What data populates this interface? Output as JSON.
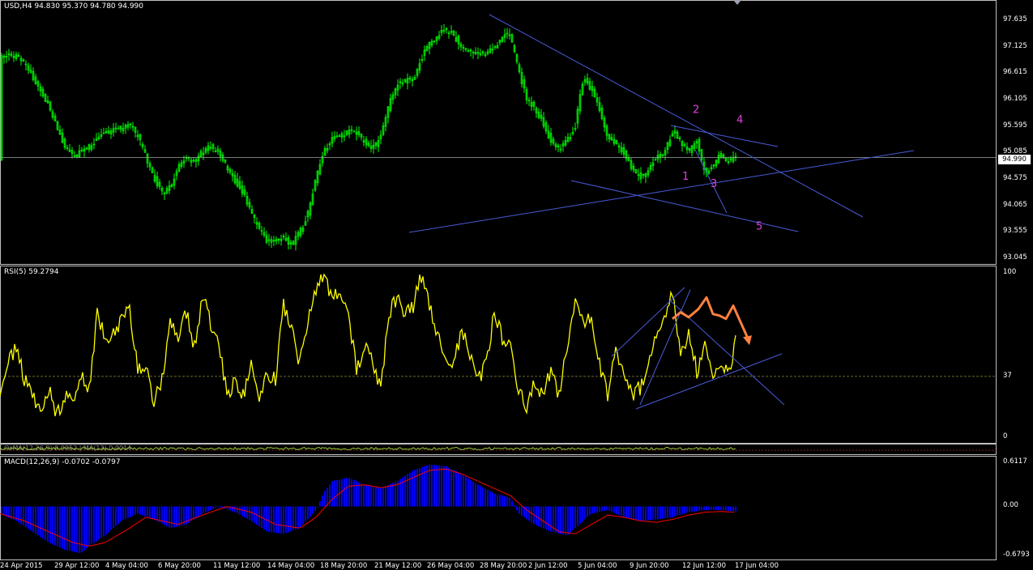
{
  "chart_data": [
    {
      "type": "candlestick",
      "title": "USD,H4  94.830 95.370 94.780 94.990",
      "ylim": [
        93.0,
        97.9
      ],
      "y_ticks": [
        "97.635",
        "97.125",
        "96.615",
        "96.105",
        "95.595",
        "95.085",
        "94.575",
        "94.065",
        "93.555",
        "93.045"
      ],
      "current_price": "94.990",
      "price_path": [
        [
          0,
          96.95
        ],
        [
          10,
          96.95
        ],
        [
          20,
          96.95
        ],
        [
          30,
          96.8
        ],
        [
          40,
          96.55
        ],
        [
          50,
          96.3
        ],
        [
          60,
          96.0
        ],
        [
          70,
          95.6
        ],
        [
          80,
          95.2
        ],
        [
          90,
          95.0
        ],
        [
          100,
          95.1
        ],
        [
          110,
          95.2
        ],
        [
          120,
          95.35
        ],
        [
          130,
          95.45
        ],
        [
          140,
          95.5
        ],
        [
          150,
          95.55
        ],
        [
          160,
          95.65
        ],
        [
          170,
          95.4
        ],
        [
          180,
          95.0
        ],
        [
          190,
          94.6
        ],
        [
          200,
          94.3
        ],
        [
          210,
          94.4
        ],
        [
          220,
          94.8
        ],
        [
          230,
          95.0
        ],
        [
          240,
          94.9
        ],
        [
          250,
          95.1
        ],
        [
          260,
          95.2
        ],
        [
          270,
          95.1
        ],
        [
          280,
          94.8
        ],
        [
          290,
          94.55
        ],
        [
          300,
          94.3
        ],
        [
          310,
          93.9
        ],
        [
          320,
          93.6
        ],
        [
          330,
          93.35
        ],
        [
          340,
          93.4
        ],
        [
          350,
          93.45
        ],
        [
          360,
          93.3
        ],
        [
          370,
          93.55
        ],
        [
          380,
          93.9
        ],
        [
          390,
          94.6
        ],
        [
          400,
          95.1
        ],
        [
          410,
          95.35
        ],
        [
          420,
          95.4
        ],
        [
          430,
          95.5
        ],
        [
          440,
          95.45
        ],
        [
          450,
          95.3
        ],
        [
          460,
          95.15
        ],
        [
          470,
          95.4
        ],
        [
          480,
          96.0
        ],
        [
          490,
          96.4
        ],
        [
          500,
          96.45
        ],
        [
          510,
          96.5
        ],
        [
          520,
          96.9
        ],
        [
          530,
          97.2
        ],
        [
          540,
          97.35
        ],
        [
          550,
          97.45
        ],
        [
          560,
          97.35
        ],
        [
          570,
          97.1
        ],
        [
          580,
          97.05
        ],
        [
          590,
          96.95
        ],
        [
          600,
          97.0
        ],
        [
          610,
          97.1
        ],
        [
          620,
          97.35
        ],
        [
          630,
          97.3
        ],
        [
          640,
          96.7
        ],
        [
          650,
          96.1
        ],
        [
          660,
          95.95
        ],
        [
          670,
          95.65
        ],
        [
          680,
          95.3
        ],
        [
          690,
          95.15
        ],
        [
          700,
          95.3
        ],
        [
          710,
          95.6
        ],
        [
          720,
          96.55
        ],
        [
          730,
          96.3
        ],
        [
          740,
          95.9
        ],
        [
          750,
          95.4
        ],
        [
          760,
          95.25
        ],
        [
          770,
          95.1
        ],
        [
          780,
          94.8
        ],
        [
          790,
          94.6
        ],
        [
          800,
          94.75
        ],
        [
          810,
          95.0
        ],
        [
          820,
          95.1
        ],
        [
          830,
          95.5
        ],
        [
          840,
          95.3
        ],
        [
          850,
          95.1
        ],
        [
          860,
          95.35
        ],
        [
          870,
          94.7
        ],
        [
          880,
          94.85
        ],
        [
          890,
          95.05
        ],
        [
          900,
          94.9
        ],
        [
          908,
          94.99
        ]
      ],
      "annotations": [
        {
          "text": "1",
          "x": 842,
          "y": 94.56
        },
        {
          "text": "2",
          "x": 855,
          "y": 95.85
        },
        {
          "text": "3",
          "x": 877,
          "y": 94.42
        },
        {
          "text": "4",
          "x": 909,
          "y": 95.65
        },
        {
          "text": "5",
          "x": 933,
          "y": 93.6
        }
      ]
    },
    {
      "type": "line",
      "title": "RSI(5) 59.2794",
      "ylim": [
        0,
        100
      ],
      "y_ticks": [
        "100",
        "37",
        "0"
      ],
      "level": 37,
      "series_path": [
        [
          0,
          30
        ],
        [
          10,
          45
        ],
        [
          20,
          55
        ],
        [
          30,
          35
        ],
        [
          40,
          25
        ],
        [
          50,
          17
        ],
        [
          60,
          30
        ],
        [
          70,
          12
        ],
        [
          80,
          25
        ],
        [
          90,
          20
        ],
        [
          100,
          40
        ],
        [
          110,
          30
        ],
        [
          120,
          75
        ],
        [
          130,
          60
        ],
        [
          140,
          65
        ],
        [
          150,
          70
        ],
        [
          160,
          80
        ],
        [
          170,
          40
        ],
        [
          180,
          45
        ],
        [
          190,
          20
        ],
        [
          200,
          35
        ],
        [
          210,
          70
        ],
        [
          220,
          60
        ],
        [
          230,
          75
        ],
        [
          240,
          55
        ],
        [
          250,
          85
        ],
        [
          260,
          70
        ],
        [
          270,
          60
        ],
        [
          280,
          25
        ],
        [
          290,
          35
        ],
        [
          300,
          25
        ],
        [
          310,
          45
        ],
        [
          320,
          20
        ],
        [
          330,
          40
        ],
        [
          340,
          35
        ],
        [
          350,
          80
        ],
        [
          360,
          65
        ],
        [
          370,
          45
        ],
        [
          380,
          70
        ],
        [
          390,
          90
        ],
        [
          400,
          98
        ],
        [
          410,
          85
        ],
        [
          420,
          90
        ],
        [
          430,
          75
        ],
        [
          440,
          40
        ],
        [
          450,
          55
        ],
        [
          460,
          45
        ],
        [
          470,
          30
        ],
        [
          480,
          75
        ],
        [
          490,
          85
        ],
        [
          500,
          75
        ],
        [
          510,
          80
        ],
        [
          520,
          98
        ],
        [
          530,
          80
        ],
        [
          540,
          60
        ],
        [
          550,
          50
        ],
        [
          560,
          45
        ],
        [
          570,
          65
        ],
        [
          580,
          50
        ],
        [
          590,
          35
        ],
        [
          600,
          45
        ],
        [
          610,
          75
        ],
        [
          620,
          60
        ],
        [
          630,
          55
        ],
        [
          640,
          30
        ],
        [
          650,
          18
        ],
        [
          660,
          35
        ],
        [
          670,
          25
        ],
        [
          680,
          40
        ],
        [
          690,
          25
        ],
        [
          700,
          55
        ],
        [
          710,
          85
        ],
        [
          720,
          70
        ],
        [
          730,
          75
        ],
        [
          740,
          45
        ],
        [
          750,
          25
        ],
        [
          760,
          55
        ],
        [
          770,
          40
        ],
        [
          780,
          25
        ],
        [
          790,
          30
        ],
        [
          800,
          45
        ],
        [
          810,
          65
        ],
        [
          820,
          70
        ],
        [
          830,
          90
        ],
        [
          840,
          50
        ],
        [
          850,
          65
        ],
        [
          860,
          40
        ],
        [
          870,
          55
        ],
        [
          880,
          35
        ],
        [
          890,
          45
        ],
        [
          900,
          40
        ],
        [
          908,
          59
        ]
      ],
      "arrow_path": [
        [
          830,
          72
        ],
        [
          840,
          76
        ],
        [
          850,
          73
        ],
        [
          862,
          78
        ],
        [
          872,
          85
        ],
        [
          880,
          75
        ],
        [
          888,
          74
        ],
        [
          896,
          72
        ],
        [
          905,
          80
        ],
        [
          925,
          58
        ]
      ]
    },
    {
      "type": "line",
      "title": "OsMA(12,26,9) 0.0052 | MA(13) 0.0014"
    },
    {
      "type": "bar",
      "title": "MACD(12,26,9) -0.0702 -0.0797",
      "ylim": [
        -0.6793,
        0.6117
      ],
      "y_ticks": [
        "0.6117",
        "0.00",
        "-0.6793"
      ],
      "histogram_path": [
        [
          0,
          -0.1
        ],
        [
          20,
          -0.2
        ],
        [
          40,
          -0.35
        ],
        [
          60,
          -0.5
        ],
        [
          80,
          -0.6
        ],
        [
          100,
          -0.65
        ],
        [
          110,
          -0.55
        ],
        [
          130,
          -0.4
        ],
        [
          150,
          -0.2
        ],
        [
          170,
          -0.1
        ],
        [
          190,
          -0.18
        ],
        [
          210,
          -0.3
        ],
        [
          230,
          -0.25
        ],
        [
          250,
          -0.1
        ],
        [
          270,
          0.0
        ],
        [
          290,
          -0.08
        ],
        [
          310,
          -0.2
        ],
        [
          330,
          -0.35
        ],
        [
          350,
          -0.38
        ],
        [
          370,
          -0.3
        ],
        [
          390,
          -0.05
        ],
        [
          400,
          0.2
        ],
        [
          410,
          0.35
        ],
        [
          430,
          0.4
        ],
        [
          450,
          0.3
        ],
        [
          470,
          0.25
        ],
        [
          490,
          0.35
        ],
        [
          510,
          0.5
        ],
        [
          530,
          0.58
        ],
        [
          550,
          0.56
        ],
        [
          570,
          0.45
        ],
        [
          590,
          0.3
        ],
        [
          610,
          0.18
        ],
        [
          630,
          0.12
        ],
        [
          640,
          -0.1
        ],
        [
          660,
          -0.25
        ],
        [
          680,
          -0.35
        ],
        [
          700,
          -0.4
        ],
        [
          710,
          -0.3
        ],
        [
          730,
          -0.1
        ],
        [
          750,
          -0.05
        ],
        [
          770,
          -0.15
        ],
        [
          790,
          -0.2
        ],
        [
          810,
          -0.18
        ],
        [
          830,
          -0.15
        ],
        [
          850,
          -0.08
        ],
        [
          870,
          -0.05
        ],
        [
          890,
          -0.05
        ],
        [
          908,
          -0.07
        ]
      ],
      "signal_path": [
        [
          0,
          -0.1
        ],
        [
          30,
          -0.2
        ],
        [
          60,
          -0.35
        ],
        [
          90,
          -0.5
        ],
        [
          110,
          -0.55
        ],
        [
          130,
          -0.5
        ],
        [
          160,
          -0.3
        ],
        [
          180,
          -0.15
        ],
        [
          200,
          -0.2
        ],
        [
          220,
          -0.25
        ],
        [
          250,
          -0.12
        ],
        [
          280,
          0.0
        ],
        [
          310,
          -0.08
        ],
        [
          340,
          -0.25
        ],
        [
          370,
          -0.3
        ],
        [
          390,
          -0.15
        ],
        [
          410,
          0.1
        ],
        [
          430,
          0.28
        ],
        [
          450,
          0.3
        ],
        [
          470,
          0.26
        ],
        [
          490,
          0.3
        ],
        [
          510,
          0.4
        ],
        [
          530,
          0.5
        ],
        [
          550,
          0.52
        ],
        [
          570,
          0.45
        ],
        [
          590,
          0.35
        ],
        [
          610,
          0.25
        ],
        [
          630,
          0.15
        ],
        [
          650,
          -0.05
        ],
        [
          670,
          -0.2
        ],
        [
          690,
          -0.35
        ],
        [
          710,
          -0.38
        ],
        [
          730,
          -0.25
        ],
        [
          750,
          -0.12
        ],
        [
          770,
          -0.15
        ],
        [
          790,
          -0.2
        ],
        [
          810,
          -0.22
        ],
        [
          830,
          -0.18
        ],
        [
          850,
          -0.12
        ],
        [
          870,
          -0.08
        ],
        [
          890,
          -0.07
        ],
        [
          908,
          -0.08
        ]
      ]
    }
  ],
  "x_axis_labels": [
    {
      "text": "24 Apr 2015",
      "x": 20
    },
    {
      "text": "29 Apr 12:00",
      "x": 87
    },
    {
      "text": "4 May 04:00",
      "x": 150
    },
    {
      "text": "6 May 20:00",
      "x": 215
    },
    {
      "text": "11 May 12:00",
      "x": 283
    },
    {
      "text": "14 May 04:00",
      "x": 350
    },
    {
      "text": "18 May 20:00",
      "x": 415
    },
    {
      "text": "21 May 12:00",
      "x": 482
    },
    {
      "text": "26 May 04:00",
      "x": 547
    },
    {
      "text": "28 May 20:00",
      "x": 612
    },
    {
      "text": "2 Jun 12:00",
      "x": 672
    },
    {
      "text": "5 Jun 04:00",
      "x": 733
    },
    {
      "text": "9 Jun 20:00",
      "x": 797
    },
    {
      "text": "12 Jun 12:00",
      "x": 862
    },
    {
      "text": "17 Jun 04:00",
      "x": 927
    }
  ],
  "colors": {
    "candle": "#00ff00",
    "rsi": "#ffff00",
    "arrow": "#ff8040",
    "trendline": "#4a5ad8",
    "label": "#e040e0",
    "macd_hist": "#0000ff",
    "macd_signal": "#ff0000",
    "osma": "#9acd32"
  }
}
